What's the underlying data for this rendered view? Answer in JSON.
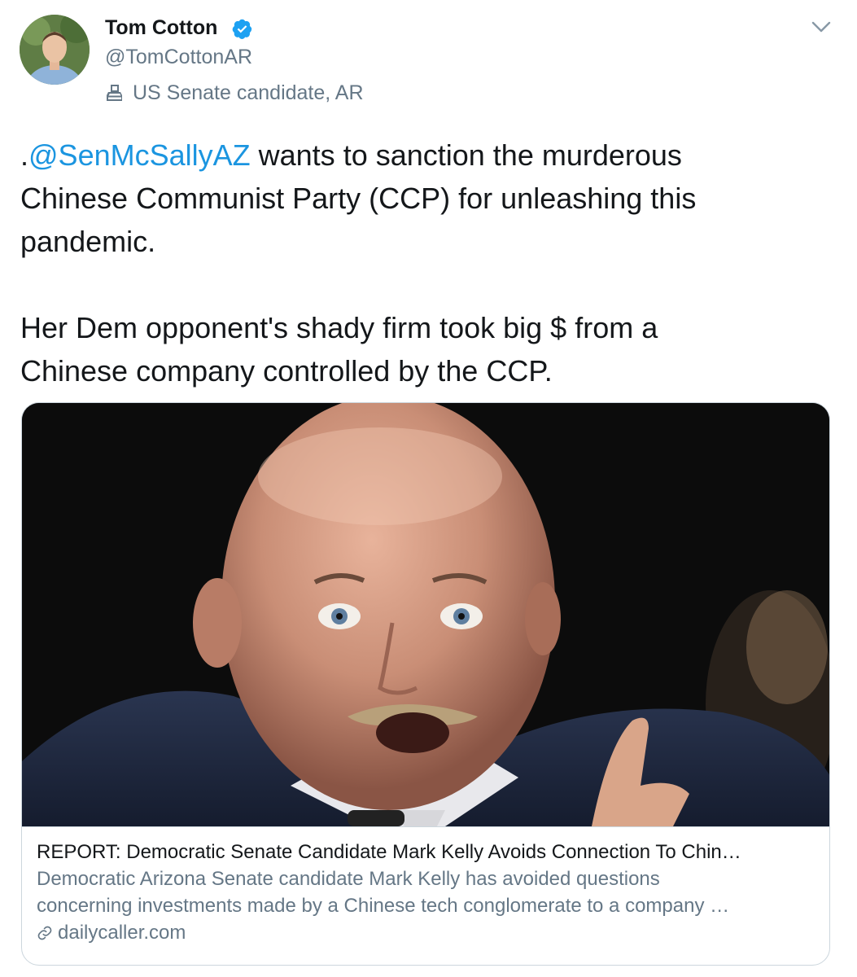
{
  "author": {
    "name": "Tom Cotton",
    "handle": "@TomCottonAR",
    "label": "US Senate candidate, AR"
  },
  "tweet": {
    "mention": "@SenMcSallyAZ",
    "line1_prefix": ".",
    "line1_rest": " wants to sanction the murderous",
    "line2": "Chinese Communist Party (CCP) for unleashing this",
    "line3": "pandemic.",
    "line4": "Her Dem opponent's shady firm took big $ from a",
    "line5": "Chinese company controlled by the CCP."
  },
  "card": {
    "title": "REPORT: Democratic Senate Candidate Mark Kelly Avoids Connection To Chin…",
    "description_line1": "Democratic Arizona Senate candidate Mark Kelly has avoided questions",
    "description_line2": "concerning investments made by a Chinese tech conglomerate to a company …",
    "domain": "dailycaller.com"
  },
  "colors": {
    "link": "#1b95e0",
    "secondary_text": "#657786",
    "primary_text": "#14171a",
    "border": "#ccd6dd"
  },
  "icons": {
    "verified": "verified-badge-icon",
    "label": "ballot-box-icon",
    "menu": "chevron-down-icon",
    "link": "link-icon"
  }
}
